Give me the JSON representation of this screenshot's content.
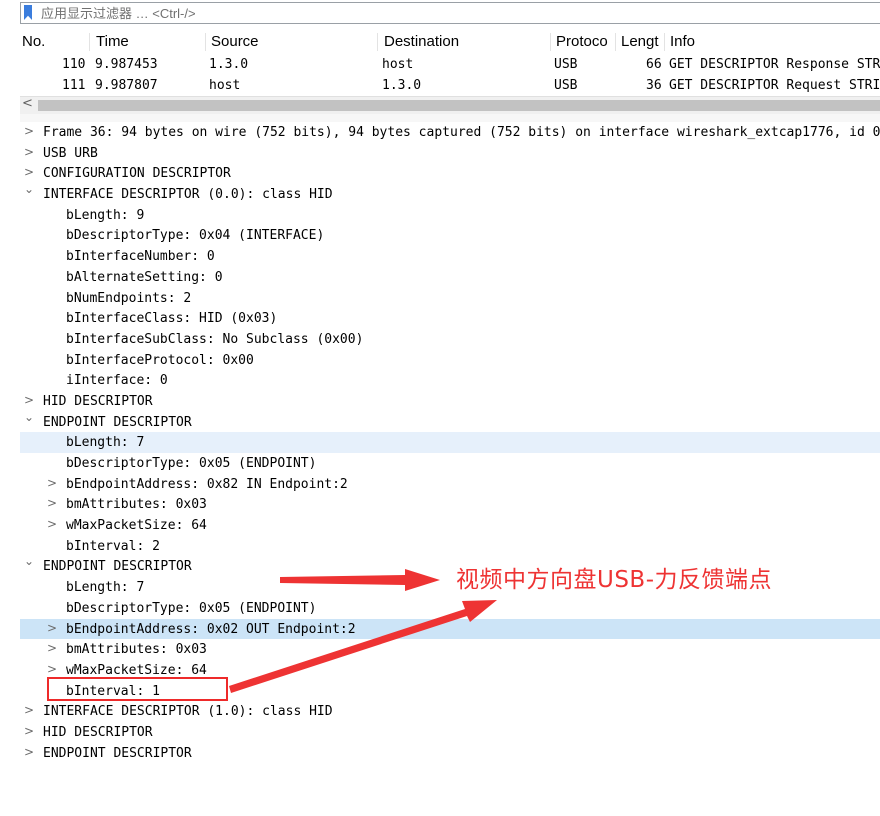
{
  "filter": {
    "placeholder": "应用显示过滤器 … <Ctrl-/>"
  },
  "columns": {
    "no": "No.",
    "time": "Time",
    "source": "Source",
    "destination": "Destination",
    "protocol": "Protoco",
    "length": "Lengt",
    "info": "Info"
  },
  "packets": [
    {
      "no": "110",
      "time": "9.987453",
      "source": "1.3.0",
      "destination": "host",
      "protocol": "USB",
      "length": "66",
      "info": "GET DESCRIPTOR Response STRING"
    },
    {
      "no": "111",
      "time": "9.987807",
      "source": "host",
      "destination": "1.3.0",
      "protocol": "USB",
      "length": "36",
      "info": "GET DESCRIPTOR Request STRING"
    }
  ],
  "scroll_left_arrow": "<",
  "tree": [
    {
      "text": "Frame 36: 94 bytes on wire (752 bits), 94 bytes captured (752 bits) on interface wireshark_extcap1776, id 0",
      "toggle": ">"
    },
    {
      "text": "USB URB",
      "toggle": ">"
    },
    {
      "text": "CONFIGURATION DESCRIPTOR",
      "toggle": ">"
    },
    {
      "text": "INTERFACE DESCRIPTOR (0.0): class HID",
      "toggle": "⌄"
    },
    {
      "text": "bLength: 9"
    },
    {
      "text": "bDescriptorType: 0x04 (INTERFACE)"
    },
    {
      "text": "bInterfaceNumber: 0"
    },
    {
      "text": "bAlternateSetting: 0"
    },
    {
      "text": "bNumEndpoints: 2"
    },
    {
      "text": "bInterfaceClass: HID (0x03)"
    },
    {
      "text": "bInterfaceSubClass: No Subclass (0x00)"
    },
    {
      "text": "bInterfaceProtocol: 0x00"
    },
    {
      "text": "iInterface: 0"
    },
    {
      "text": "HID DESCRIPTOR",
      "toggle": ">"
    },
    {
      "text": "ENDPOINT DESCRIPTOR",
      "toggle": "⌄"
    },
    {
      "text": "bLength: 7"
    },
    {
      "text": "bDescriptorType: 0x05 (ENDPOINT)"
    },
    {
      "text": "bEndpointAddress: 0x82  IN  Endpoint:2",
      "toggle": ">"
    },
    {
      "text": "bmAttributes: 0x03",
      "toggle": ">"
    },
    {
      "text": "wMaxPacketSize: 64",
      "toggle": ">"
    },
    {
      "text": "bInterval: 2"
    },
    {
      "text": "ENDPOINT DESCRIPTOR",
      "toggle": "⌄"
    },
    {
      "text": "bLength: 7"
    },
    {
      "text": "bDescriptorType: 0x05 (ENDPOINT)"
    },
    {
      "text": "bEndpointAddress: 0x02  OUT  Endpoint:2",
      "toggle": ">"
    },
    {
      "text": "bmAttributes: 0x03",
      "toggle": ">"
    },
    {
      "text": "wMaxPacketSize: 64",
      "toggle": ">"
    },
    {
      "text": "bInterval: 1"
    },
    {
      "text": "INTERFACE DESCRIPTOR (1.0): class HID",
      "toggle": ">"
    },
    {
      "text": "HID DESCRIPTOR",
      "toggle": ">"
    },
    {
      "text": "ENDPOINT DESCRIPTOR",
      "toggle": ">"
    }
  ],
  "annotation": {
    "text": "视频中方向盘USB-力反馈端点",
    "color": "#ee3333"
  },
  "colors": {
    "selected_row": "#cce4f7",
    "highlight_row": "#e6f0fb",
    "accent": "#3b7ddd"
  }
}
